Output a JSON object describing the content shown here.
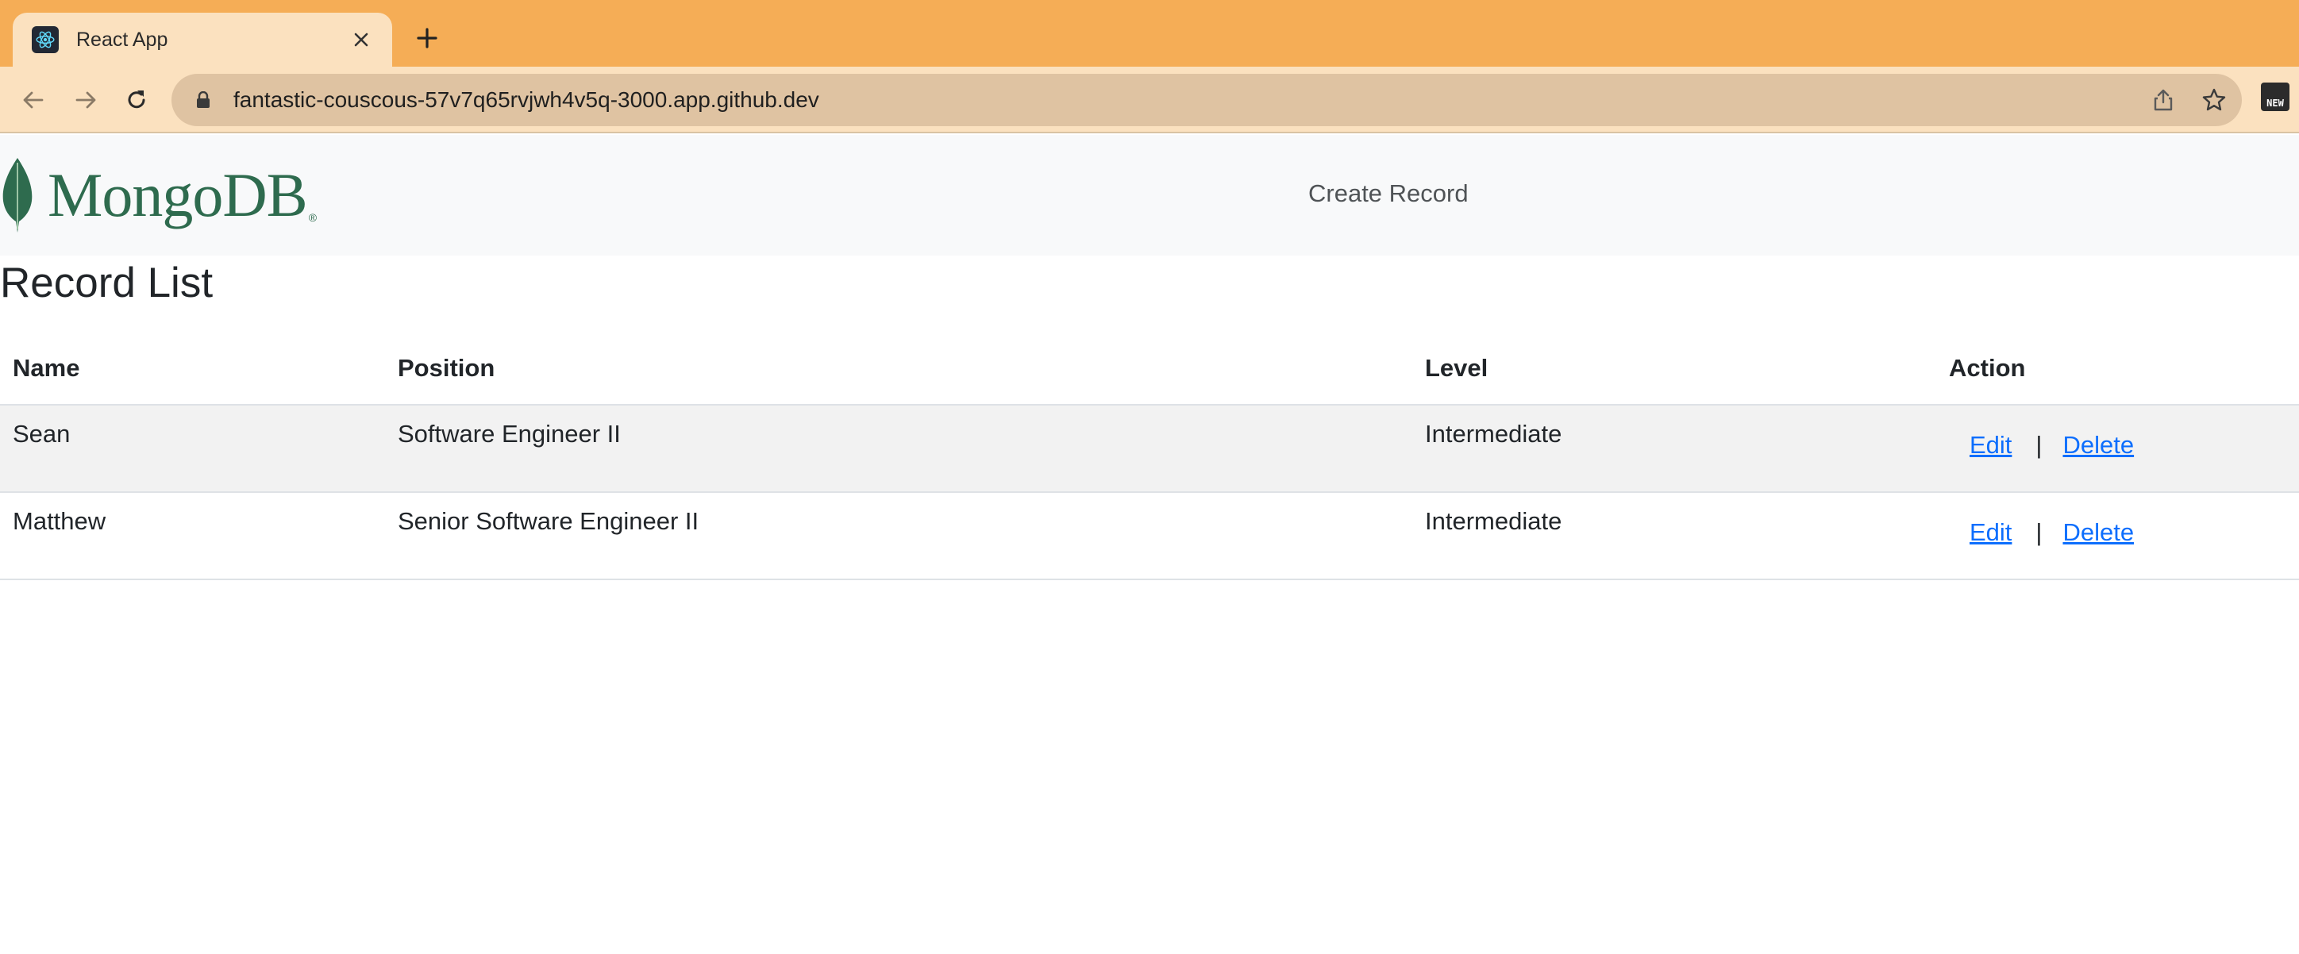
{
  "browser": {
    "tab_title": "React App",
    "url": "fantastic-couscous-57v7q65rvjwh4v5q-3000.app.github.dev",
    "icons": [
      "back-icon",
      "forward-icon",
      "reload-icon",
      "lock-icon",
      "share-icon",
      "star-icon",
      "extension-icon"
    ],
    "extension_label": "NEW"
  },
  "navbar": {
    "brand": "MongoDB",
    "brand_mark": "®",
    "create_link": "Create Record"
  },
  "page": {
    "title": "Record List"
  },
  "table": {
    "headers": {
      "name": "Name",
      "position": "Position",
      "level": "Level",
      "action": "Action"
    },
    "rows": [
      {
        "name": "Sean",
        "position": "Software Engineer II",
        "level": "Intermediate"
      },
      {
        "name": "Matthew",
        "position": "Senior Software Engineer II",
        "level": "Intermediate"
      }
    ],
    "actions": {
      "edit": "Edit",
      "separator": "|",
      "delete": "Delete"
    }
  },
  "colors": {
    "tab_strip": "#f5ad56",
    "toolbar": "#fbe1bf",
    "brand_green": "#2e6b4e",
    "link_blue": "#0d6efd"
  }
}
